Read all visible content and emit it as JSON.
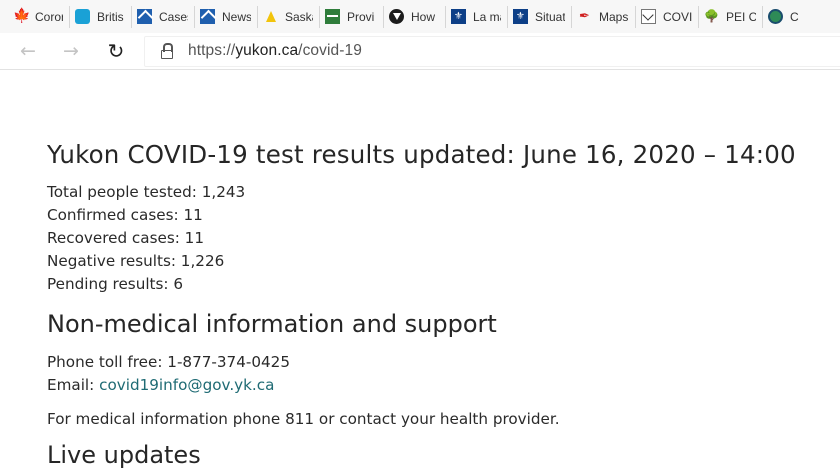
{
  "bookmarks": [
    {
      "label": "Coror",
      "icon": "maple-leaf-icon"
    },
    {
      "label": "Britis",
      "icon": "bc-icon"
    },
    {
      "label": "Cases",
      "icon": "alberta-icon"
    },
    {
      "label": "News",
      "icon": "alberta-icon"
    },
    {
      "label": "Saska",
      "icon": "saskatchewan-icon"
    },
    {
      "label": "Provi",
      "icon": "manitoba-icon"
    },
    {
      "label": "How",
      "icon": "ontario-icon"
    },
    {
      "label": "La ma",
      "icon": "quebec-icon"
    },
    {
      "label": "Situat",
      "icon": "quebec-icon"
    },
    {
      "label": "Maps",
      "icon": "new-brunswick-icon"
    },
    {
      "label": "COVI",
      "icon": "nl-icon"
    },
    {
      "label": "PEI C",
      "icon": "pei-icon"
    },
    {
      "label": "C",
      "icon": "nova-scotia-icon"
    }
  ],
  "address": {
    "scheme": "https://",
    "domain": "yukon.ca",
    "path": "/covid-19"
  },
  "page": {
    "title": "Yukon COVID-19 test results updated: June 16, 2020 – 14:00",
    "stats": [
      "Total people tested: 1,243",
      "Confirmed cases: 11",
      "Recovered cases: 11",
      "Negative results: 1,226",
      "Pending results: 6"
    ],
    "support_heading": "Non-medical information and support",
    "phone_text": "Phone toll free: 1-877-374-0425",
    "email_label": "Email: ",
    "email_link": "covid19info@gov.yk.ca",
    "medical_text": "For medical information phone 811 or contact your health provider.",
    "live_heading": "Live updates"
  },
  "colors": {
    "link": "#1f6b74",
    "text": "#262626"
  }
}
